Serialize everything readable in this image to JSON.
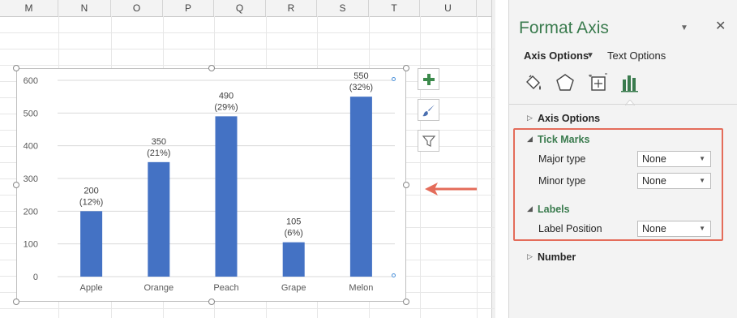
{
  "spreadsheet": {
    "columns": [
      "M",
      "N",
      "O",
      "P",
      "Q",
      "R",
      "S",
      "T",
      "U"
    ]
  },
  "chart_data": {
    "type": "bar",
    "categories": [
      "Apple",
      "Orange",
      "Peach",
      "Grape",
      "Melon"
    ],
    "values": [
      200,
      350,
      490,
      105,
      550
    ],
    "data_labels": [
      [
        "200",
        "(12%)"
      ],
      [
        "350",
        "(21%)"
      ],
      [
        "490",
        "(29%)"
      ],
      [
        "105",
        "(6%)"
      ],
      [
        "550",
        "(32%)"
      ]
    ],
    "yticks": [
      "0",
      "100",
      "200",
      "300",
      "400",
      "500",
      "600"
    ],
    "ylim": [
      0,
      600
    ],
    "grid": true,
    "bar_color": "#4472c4"
  },
  "chart_buttons": [
    {
      "icon": "plus-icon",
      "name": "chart-elements-button"
    },
    {
      "icon": "brush-icon",
      "name": "chart-styles-button"
    },
    {
      "icon": "filter-icon",
      "name": "chart-filters-button"
    }
  ],
  "panel": {
    "title": "Format Axis",
    "tabs": {
      "axis_options": "Axis Options",
      "text_options": "Text Options"
    },
    "sections": {
      "axis_options": "Axis Options",
      "tick_marks": "Tick Marks",
      "labels": "Labels",
      "number": "Number"
    },
    "tick_marks": {
      "major_label": "Major type",
      "major_value": "None",
      "minor_label": "Minor type",
      "minor_value": "None"
    },
    "labels": {
      "position_label": "Label Position",
      "position_value": "None"
    },
    "accent_color": "#3a7b4e",
    "highlight_color": "#e46c5a"
  }
}
